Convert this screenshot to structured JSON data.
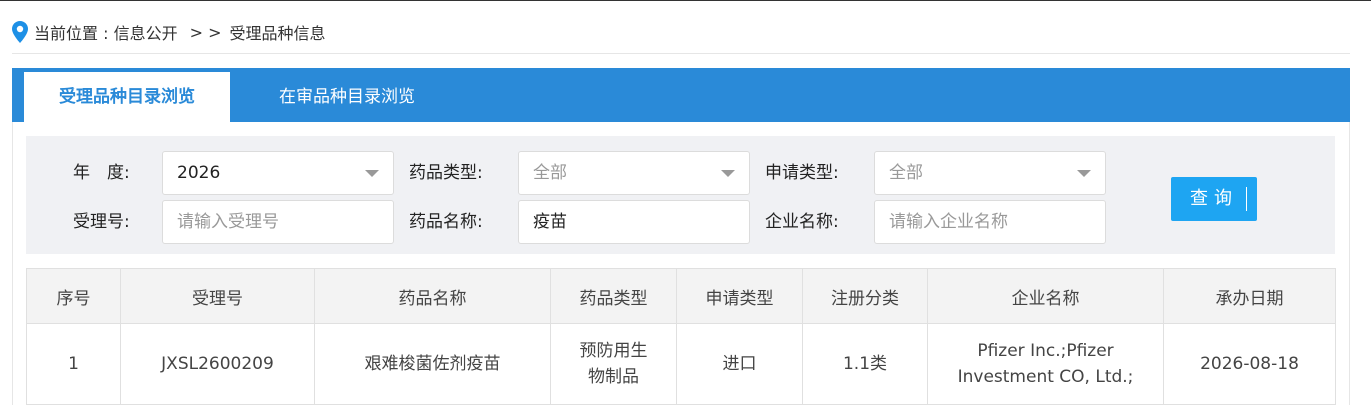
{
  "breadcrumb": {
    "prefix": "当前位置 : 信息公开",
    "separator": "> >",
    "current": "受理品种信息"
  },
  "tabs": [
    {
      "label": "受理品种目录浏览",
      "active": true
    },
    {
      "label": "在审品种目录浏览",
      "active": false
    }
  ],
  "filters": {
    "year": {
      "label": "年　度:",
      "value": "2026"
    },
    "drug_type": {
      "label": "药品类型:",
      "value": "全部"
    },
    "apply_type": {
      "label": "申请类型:",
      "value": "全部"
    },
    "accept_no": {
      "label": "受理号:",
      "placeholder": "请输入受理号"
    },
    "drug_name": {
      "label": "药品名称:",
      "value": "疫苗"
    },
    "company": {
      "label": "企业名称:",
      "placeholder": "请输入企业名称"
    },
    "query_button": "查询"
  },
  "table": {
    "headers": [
      "序号",
      "受理号",
      "药品名称",
      "药品类型",
      "申请类型",
      "注册分类",
      "企业名称",
      "承办日期"
    ],
    "rows": [
      {
        "index": "1",
        "accept_no": "JXSL2600209",
        "drug_name": "艰难梭菌佐剂疫苗",
        "drug_type": "预防用生物制品",
        "apply_type": "进口",
        "reg_class": "1.1类",
        "company": "Pfizer Inc.;Pfizer Investment CO, Ltd.;",
        "date": "2026-08-18"
      }
    ]
  },
  "colors": {
    "tab_bar": "#2a8ad8",
    "query_button": "#1ea5f2",
    "filter_bg": "#f0f1f4",
    "pin": "#1e90e6"
  },
  "icons": {
    "breadcrumb": "location-pin-icon",
    "select": "chevron-down-icon"
  }
}
